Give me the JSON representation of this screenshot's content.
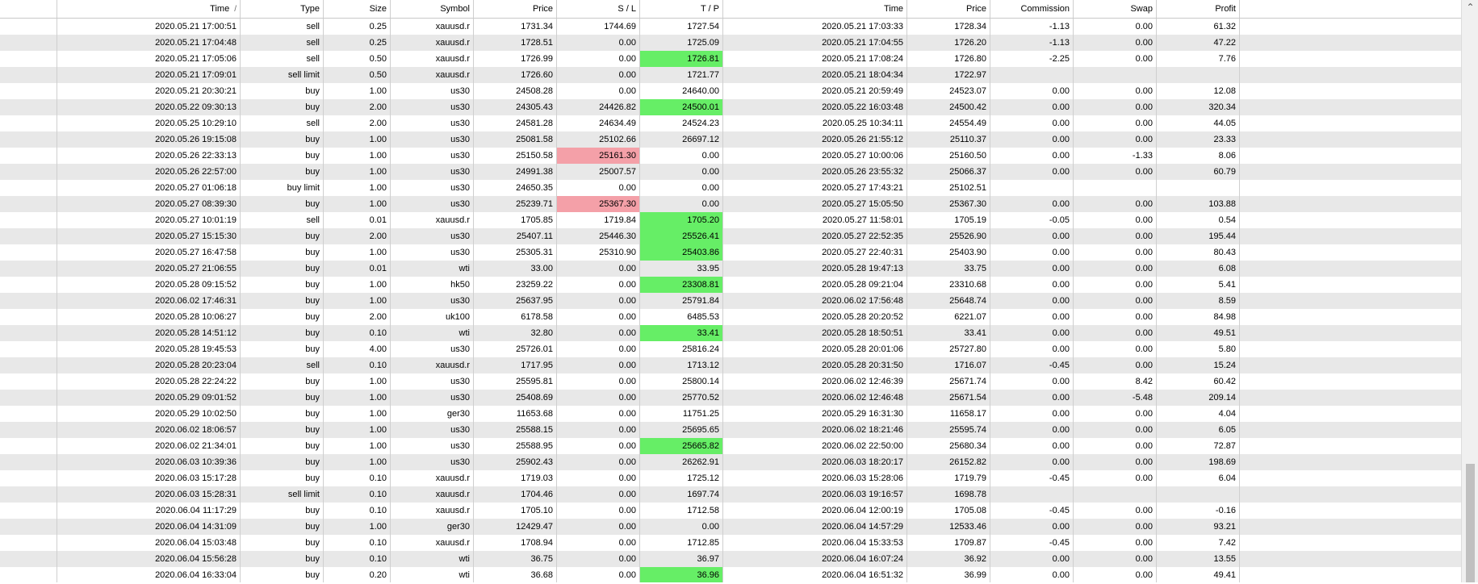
{
  "table": {
    "headers": [
      "",
      "Time",
      "Type",
      "Size",
      "Symbol",
      "Price",
      "S / L",
      "T / P",
      "Time",
      "Price",
      "Commission",
      "Swap",
      "Profit"
    ],
    "sort_indicator": "/",
    "rows": [
      [
        "",
        "2020.05.21 17:00:51",
        "sell",
        "0.25",
        "xauusd.r",
        "1731.34",
        "1744.69",
        "1727.54",
        "2020.05.21 17:03:33",
        "1728.34",
        "-1.13",
        "0.00",
        "61.32"
      ],
      [
        "",
        "2020.05.21 17:04:48",
        "sell",
        "0.25",
        "xauusd.r",
        "1728.51",
        "0.00",
        "1725.09",
        "2020.05.21 17:04:55",
        "1726.20",
        "-1.13",
        "0.00",
        "47.22"
      ],
      [
        "",
        "2020.05.21 17:05:06",
        "sell",
        "0.50",
        "xauusd.r",
        "1726.99",
        "0.00",
        "1726.81",
        "2020.05.21 17:08:24",
        "1726.80",
        "-2.25",
        "0.00",
        "7.76"
      ],
      [
        "",
        "2020.05.21 17:09:01",
        "sell limit",
        "0.50",
        "xauusd.r",
        "1726.60",
        "0.00",
        "1721.77",
        "2020.05.21 18:04:34",
        "1722.97",
        "",
        "",
        ""
      ],
      [
        "",
        "2020.05.21 20:30:21",
        "buy",
        "1.00",
        "us30",
        "24508.28",
        "0.00",
        "24640.00",
        "2020.05.21 20:59:49",
        "24523.07",
        "0.00",
        "0.00",
        "12.08"
      ],
      [
        "",
        "2020.05.22 09:30:13",
        "buy",
        "2.00",
        "us30",
        "24305.43",
        "24426.82",
        "24500.01",
        "2020.05.22 16:03:48",
        "24500.42",
        "0.00",
        "0.00",
        "320.34"
      ],
      [
        "",
        "2020.05.25 10:29:10",
        "sell",
        "2.00",
        "us30",
        "24581.28",
        "24634.49",
        "24524.23",
        "2020.05.25 10:34:11",
        "24554.49",
        "0.00",
        "0.00",
        "44.05"
      ],
      [
        "",
        "2020.05.26 19:15:08",
        "buy",
        "1.00",
        "us30",
        "25081.58",
        "25102.66",
        "26697.12",
        "2020.05.26 21:55:12",
        "25110.37",
        "0.00",
        "0.00",
        "23.33"
      ],
      [
        "",
        "2020.05.26 22:33:13",
        "buy",
        "1.00",
        "us30",
        "25150.58",
        "25161.30",
        "0.00",
        "2020.05.27 10:00:06",
        "25160.50",
        "0.00",
        "-1.33",
        "8.06"
      ],
      [
        "",
        "2020.05.26 22:57:00",
        "buy",
        "1.00",
        "us30",
        "24991.38",
        "25007.57",
        "0.00",
        "2020.05.26 23:55:32",
        "25066.37",
        "0.00",
        "0.00",
        "60.79"
      ],
      [
        "",
        "2020.05.27 01:06:18",
        "buy limit",
        "1.00",
        "us30",
        "24650.35",
        "0.00",
        "0.00",
        "2020.05.27 17:43:21",
        "25102.51",
        "",
        "",
        ""
      ],
      [
        "",
        "2020.05.27 08:39:30",
        "buy",
        "1.00",
        "us30",
        "25239.71",
        "25367.30",
        "0.00",
        "2020.05.27 15:05:50",
        "25367.30",
        "0.00",
        "0.00",
        "103.88"
      ],
      [
        "",
        "2020.05.27 10:01:19",
        "sell",
        "0.01",
        "xauusd.r",
        "1705.85",
        "1719.84",
        "1705.20",
        "2020.05.27 11:58:01",
        "1705.19",
        "-0.05",
        "0.00",
        "0.54"
      ],
      [
        "",
        "2020.05.27 15:15:30",
        "buy",
        "2.00",
        "us30",
        "25407.11",
        "25446.30",
        "25526.41",
        "2020.05.27 22:52:35",
        "25526.90",
        "0.00",
        "0.00",
        "195.44"
      ],
      [
        "",
        "2020.05.27 16:47:58",
        "buy",
        "1.00",
        "us30",
        "25305.31",
        "25310.90",
        "25403.86",
        "2020.05.27 22:40:31",
        "25403.90",
        "0.00",
        "0.00",
        "80.43"
      ],
      [
        "",
        "2020.05.27 21:06:55",
        "buy",
        "0.01",
        "wti",
        "33.00",
        "0.00",
        "33.95",
        "2020.05.28 19:47:13",
        "33.75",
        "0.00",
        "0.00",
        "6.08"
      ],
      [
        "",
        "2020.05.28 09:15:52",
        "buy",
        "1.00",
        "hk50",
        "23259.22",
        "0.00",
        "23308.81",
        "2020.05.28 09:21:04",
        "23310.68",
        "0.00",
        "0.00",
        "5.41"
      ],
      [
        "",
        "2020.06.02 17:46:31",
        "buy",
        "1.00",
        "us30",
        "25637.95",
        "0.00",
        "25791.84",
        "2020.06.02 17:56:48",
        "25648.74",
        "0.00",
        "0.00",
        "8.59"
      ],
      [
        "",
        "2020.05.28 10:06:27",
        "buy",
        "2.00",
        "uk100",
        "6178.58",
        "0.00",
        "6485.53",
        "2020.05.28 20:20:52",
        "6221.07",
        "0.00",
        "0.00",
        "84.98"
      ],
      [
        "",
        "2020.05.28 14:51:12",
        "buy",
        "0.10",
        "wti",
        "32.80",
        "0.00",
        "33.41",
        "2020.05.28 18:50:51",
        "33.41",
        "0.00",
        "0.00",
        "49.51"
      ],
      [
        "",
        "2020.05.28 19:45:53",
        "buy",
        "4.00",
        "us30",
        "25726.01",
        "0.00",
        "25816.24",
        "2020.05.28 20:01:06",
        "25727.80",
        "0.00",
        "0.00",
        "5.80"
      ],
      [
        "",
        "2020.05.28 20:23:04",
        "sell",
        "0.10",
        "xauusd.r",
        "1717.95",
        "0.00",
        "1713.12",
        "2020.05.28 20:31:50",
        "1716.07",
        "-0.45",
        "0.00",
        "15.24"
      ],
      [
        "",
        "2020.05.28 22:24:22",
        "buy",
        "1.00",
        "us30",
        "25595.81",
        "0.00",
        "25800.14",
        "2020.06.02 12:46:39",
        "25671.74",
        "0.00",
        "8.42",
        "60.42"
      ],
      [
        "",
        "2020.05.29 09:01:52",
        "buy",
        "1.00",
        "us30",
        "25408.69",
        "0.00",
        "25770.52",
        "2020.06.02 12:46:48",
        "25671.54",
        "0.00",
        "-5.48",
        "209.14"
      ],
      [
        "",
        "2020.05.29 10:02:50",
        "buy",
        "1.00",
        "ger30",
        "11653.68",
        "0.00",
        "11751.25",
        "2020.05.29 16:31:30",
        "11658.17",
        "0.00",
        "0.00",
        "4.04"
      ],
      [
        "",
        "2020.06.02 18:06:57",
        "buy",
        "1.00",
        "us30",
        "25588.15",
        "0.00",
        "25695.65",
        "2020.06.02 18:21:46",
        "25595.74",
        "0.00",
        "0.00",
        "6.05"
      ],
      [
        "",
        "2020.06.02 21:34:01",
        "buy",
        "1.00",
        "us30",
        "25588.95",
        "0.00",
        "25665.82",
        "2020.06.02 22:50:00",
        "25680.34",
        "0.00",
        "0.00",
        "72.87"
      ],
      [
        "",
        "2020.06.03 10:39:36",
        "buy",
        "1.00",
        "us30",
        "25902.43",
        "0.00",
        "26262.91",
        "2020.06.03 18:20:17",
        "26152.82",
        "0.00",
        "0.00",
        "198.69"
      ],
      [
        "",
        "2020.06.03 15:17:28",
        "buy",
        "0.10",
        "xauusd.r",
        "1719.03",
        "0.00",
        "1725.12",
        "2020.06.03 15:28:06",
        "1719.79",
        "-0.45",
        "0.00",
        "6.04"
      ],
      [
        "",
        "2020.06.03 15:28:31",
        "sell limit",
        "0.10",
        "xauusd.r",
        "1704.46",
        "0.00",
        "1697.74",
        "2020.06.03 19:16:57",
        "1698.78",
        "",
        "",
        ""
      ],
      [
        "",
        "2020.06.04 11:17:29",
        "buy",
        "0.10",
        "xauusd.r",
        "1705.10",
        "0.00",
        "1712.58",
        "2020.06.04 12:00:19",
        "1705.08",
        "-0.45",
        "0.00",
        "-0.16"
      ],
      [
        "",
        "2020.06.04 14:31:09",
        "buy",
        "1.00",
        "ger30",
        "12429.47",
        "0.00",
        "0.00",
        "2020.06.04 14:57:29",
        "12533.46",
        "0.00",
        "0.00",
        "93.21"
      ],
      [
        "",
        "2020.06.04 15:03:48",
        "buy",
        "0.10",
        "xauusd.r",
        "1708.94",
        "0.00",
        "1712.85",
        "2020.06.04 15:33:53",
        "1709.87",
        "-0.45",
        "0.00",
        "7.42"
      ],
      [
        "",
        "2020.06.04 15:56:28",
        "buy",
        "0.10",
        "wti",
        "36.75",
        "0.00",
        "36.97",
        "2020.06.04 16:07:24",
        "36.92",
        "0.00",
        "0.00",
        "13.55"
      ],
      [
        "",
        "2020.06.04 16:33:04",
        "buy",
        "0.20",
        "wti",
        "36.68",
        "0.00",
        "36.96",
        "2020.06.04 16:51:32",
        "36.99",
        "0.00",
        "0.00",
        "49.41"
      ]
    ],
    "highlights": {
      "tp_green_rows": [
        2,
        5,
        12,
        13,
        14,
        16,
        19,
        26,
        34
      ],
      "sl_red_rows": [
        8,
        11
      ]
    }
  },
  "colors": {
    "tp_green": "#66ee66",
    "sl_red": "#f4a0a8",
    "row_alt": "#e8e8e8"
  },
  "scrollbar": {
    "up_arrow_icon": "chevron-up-icon"
  }
}
